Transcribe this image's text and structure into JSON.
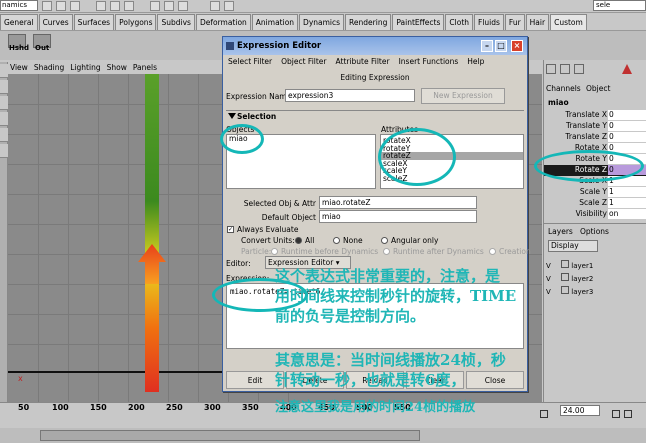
{
  "topbar": {
    "mode_label": "namics",
    "right_text": "sele"
  },
  "tabs": [
    "General",
    "Curves",
    "Surfaces",
    "Polygons",
    "Subdivs",
    "Deformation",
    "Animation",
    "Dynamics",
    "Rendering",
    "PaintEffects",
    "Cloth",
    "Fluids",
    "Fur",
    "Hair",
    "Custom"
  ],
  "shelf": {
    "items": [
      "Hshd",
      "Out"
    ]
  },
  "viewport": {
    "menu": [
      "View",
      "Shading",
      "Lighting",
      "Show",
      "Panels"
    ],
    "axis_label": "x"
  },
  "timeline": {
    "ticks": [
      "50",
      "100",
      "150",
      "200",
      "250",
      "300",
      "350",
      "400",
      "450",
      "500",
      "550"
    ],
    "current_frame": "24.00"
  },
  "channel_box": {
    "menu": [
      "Channels",
      "Object"
    ],
    "object_name": "miao",
    "channels": [
      {
        "name": "Translate X",
        "value": "0"
      },
      {
        "name": "Translate Y",
        "value": "0"
      },
      {
        "name": "Translate Z",
        "value": "0"
      },
      {
        "name": "Rotate X",
        "value": "0"
      },
      {
        "name": "Rotate Y",
        "value": "0"
      },
      {
        "name": "Rotate Z",
        "value": "0"
      },
      {
        "name": "Scale X",
        "value": "1"
      },
      {
        "name": "Scale Y",
        "value": "1"
      },
      {
        "name": "Scale Z",
        "value": "1"
      },
      {
        "name": "Visibility",
        "value": "on"
      }
    ]
  },
  "layers": {
    "title": "Layers",
    "options": "Options",
    "display": "Display",
    "items": [
      "layer1",
      "layer2",
      "layer3"
    ],
    "flag": "V"
  },
  "dialog": {
    "title": "Expression Editor",
    "menu": [
      "Select Filter",
      "Object Filter",
      "Attribute Filter",
      "Insert Functions",
      "Help"
    ],
    "subtitle": "Editing Expression",
    "expression_name_label": "Expression Name",
    "expression_name_value": "expression3",
    "new_expression_button": "New Expression",
    "selection_label": "Selection",
    "objects_label": "Objects",
    "objects": [
      "miao"
    ],
    "attributes_label": "Attributes",
    "attributes": [
      "rotateX",
      "rotateY",
      "rotateZ",
      "scaleX",
      "scaleY",
      "scaleZ"
    ],
    "selected_attr_label": "Selected Obj & Attr",
    "selected_attr_value": "miao.rotateZ",
    "default_object_label": "Default Object",
    "default_object_value": "miao",
    "always_evaluate_label": "Always Evaluate",
    "convert_units_label": "Convert Units:",
    "convert_units_options": [
      "All",
      "None",
      "Angular only"
    ],
    "particle_label": "Particle:",
    "particle_options": [
      "Runtime before Dynamics",
      "Runtime after Dynamics",
      "Creation"
    ],
    "editor_label": "Editor:",
    "editor_value": "Expression Editor",
    "expression_label": "Expression:",
    "expression_text": "miao.rotateZ=-time*6",
    "buttons": [
      "Edit",
      "Delete",
      "Reload",
      "Clear",
      "Close"
    ]
  },
  "overlay": {
    "lines": [
      "这个表达式非常重要的，注意，是",
      "用时间线来控制秒针的旋转，TIME",
      "前的负号是控制方向。",
      "其意思是：当时间线播放24桢，秒",
      "针转动一秒，也就是转6度，",
      "注意这里我是用的时间24桢的播放"
    ]
  },
  "colors": {
    "annotation": "#1fb6b6",
    "title_bar": "#7fa7e0",
    "pivot_gradient_end": "#e03020"
  }
}
